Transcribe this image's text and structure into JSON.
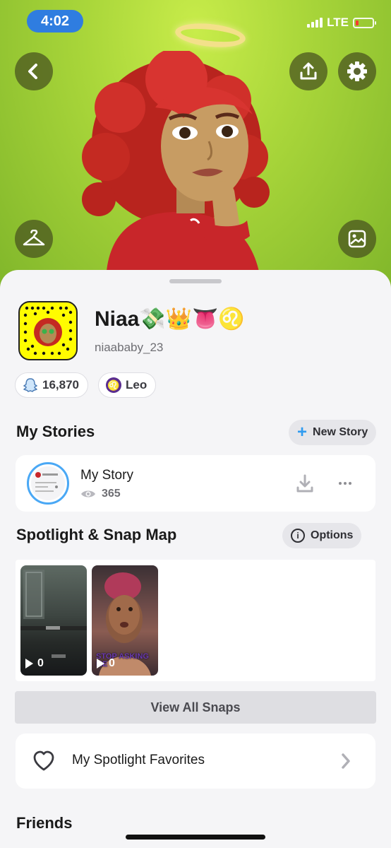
{
  "status_bar": {
    "time": "4:02",
    "network": "LTE"
  },
  "hero": {
    "icons": [
      "back-icon",
      "share-icon",
      "gear-icon",
      "hanger-icon",
      "gallery-icon"
    ],
    "background_color": "#a9d63a"
  },
  "profile": {
    "display_name": "Niaa💸👑👅♌",
    "username": "niaababy_23",
    "snap_score": "16,870",
    "zodiac": "Leo",
    "zodiac_symbol": "♌"
  },
  "my_stories": {
    "title": "My Stories",
    "new_story_label": "New Story",
    "story": {
      "title": "My Story",
      "views": "365"
    }
  },
  "spotlight": {
    "title": "Spotlight & Snap Map",
    "options_label": "Options",
    "tiles": [
      {
        "plays": "0"
      },
      {
        "plays": "0",
        "caption": "STOP ASKING ME"
      }
    ],
    "view_all_label": "View All Snaps"
  },
  "favorites": {
    "label": "My Spotlight Favorites"
  },
  "friends": {
    "title": "Friends"
  },
  "colors": {
    "snap_yellow": "#fffc00",
    "accent_blue": "#2f9bf0",
    "zodiac_purple": "#5a2d8f"
  }
}
